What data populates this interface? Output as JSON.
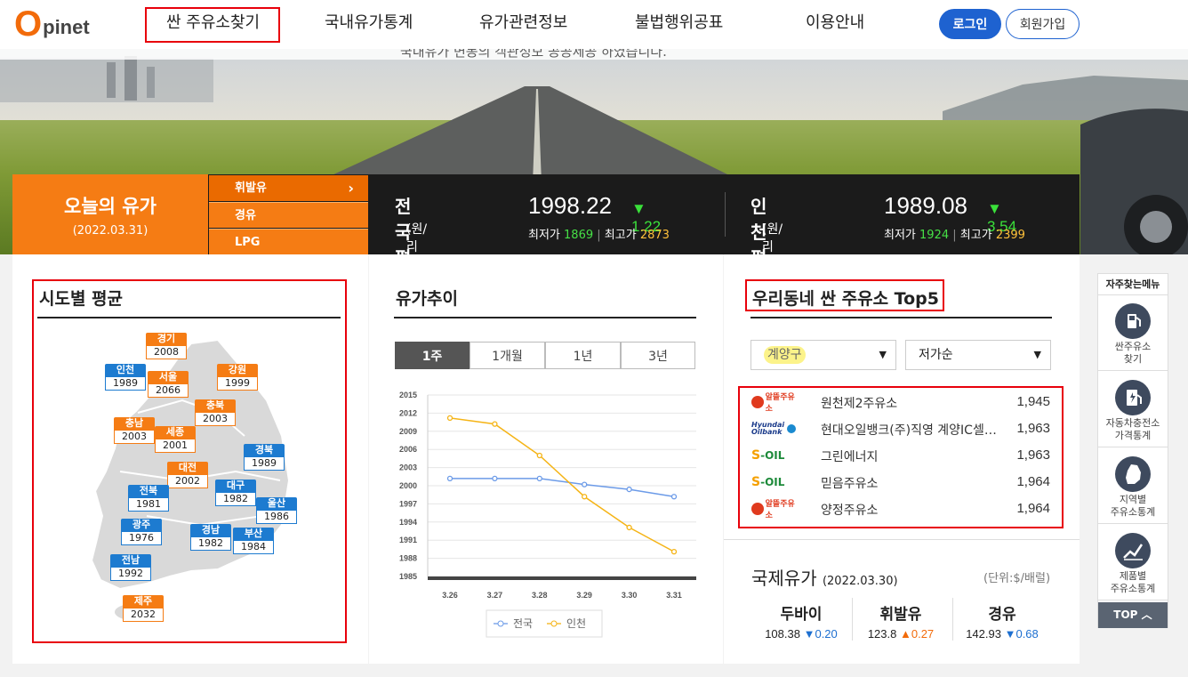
{
  "header": {
    "logo_o": "O",
    "logo_rest": "pinet",
    "nav": [
      "싼 주유소찾기",
      "국내유가통계",
      "유가관련정보",
      "불법행위공표",
      "이용안내"
    ],
    "login": "로그인",
    "join": "회원가입"
  },
  "banner": {
    "text": "국내유가 변동의 객관정보 공공제공 하였습니다."
  },
  "today": {
    "title": "오늘의 유가",
    "date": "(2022.03.31)",
    "fuels": [
      "휘발유",
      "경유",
      "LPG"
    ],
    "selected_arrow": "›"
  },
  "national": {
    "label": "전국평균",
    "unit": "(원/리터)",
    "value": "1998.22",
    "change": "▼ 1.22",
    "min_label": "최저가",
    "min": "1869",
    "sep": "|",
    "max_label": "최고가",
    "max": "2873"
  },
  "incheon": {
    "label": "인천평균",
    "unit": "(원/리터)",
    "value": "1989.08",
    "change": "▼ 3.54",
    "min_label": "최저가",
    "min": "1924",
    "sep": "|",
    "max_label": "최고가",
    "max": "2399"
  },
  "map": {
    "title": "시도별 평균",
    "regions": [
      {
        "name": "경기",
        "value": "2008",
        "color": "o"
      },
      {
        "name": "인천",
        "value": "1989",
        "color": "b"
      },
      {
        "name": "서울",
        "value": "2066",
        "color": "o"
      },
      {
        "name": "강원",
        "value": "1999",
        "color": "o"
      },
      {
        "name": "충북",
        "value": "2003",
        "color": "o"
      },
      {
        "name": "충남",
        "value": "2003",
        "color": "o"
      },
      {
        "name": "세종",
        "value": "2001",
        "color": "o"
      },
      {
        "name": "경북",
        "value": "1989",
        "color": "b"
      },
      {
        "name": "대전",
        "value": "2002",
        "color": "o"
      },
      {
        "name": "대구",
        "value": "1982",
        "color": "b"
      },
      {
        "name": "전북",
        "value": "1981",
        "color": "b"
      },
      {
        "name": "울산",
        "value": "1986",
        "color": "b"
      },
      {
        "name": "광주",
        "value": "1976",
        "color": "b"
      },
      {
        "name": "경남",
        "value": "1982",
        "color": "b"
      },
      {
        "name": "부산",
        "value": "1984",
        "color": "b"
      },
      {
        "name": "전남",
        "value": "1992",
        "color": "b"
      },
      {
        "name": "제주",
        "value": "2032",
        "color": "o"
      }
    ]
  },
  "trend": {
    "title": "유가추이",
    "tabs": [
      "1주",
      "1개월",
      "1년",
      "3년"
    ]
  },
  "chart_data": {
    "type": "line",
    "x": [
      "3.26",
      "3.27",
      "3.28",
      "3.29",
      "3.30",
      "3.31"
    ],
    "yticks": [
      "2015",
      "2012",
      "2009",
      "2006",
      "2003",
      "2000",
      "1997",
      "1994",
      "1991",
      "1988",
      "1985"
    ],
    "ylim": [
      1985,
      2015
    ],
    "series": [
      {
        "name": "전국",
        "color": "#6c9be8",
        "values": [
          2001.2,
          2001.2,
          2001.2,
          2000.2,
          1999.4,
          1998.2
        ]
      },
      {
        "name": "인천",
        "color": "#f5b416",
        "values": [
          2011.2,
          2010.2,
          2005.0,
          1998.2,
          1993.1,
          1989.1
        ]
      }
    ],
    "legend": "bottom"
  },
  "top5": {
    "title": "우리동네 싼 주유소 Top5",
    "district": "계양구",
    "sort": "저가순",
    "stations": [
      {
        "brand": "알뜰주유소",
        "name": "원천제2주유소",
        "price": "1,945"
      },
      {
        "brand": "Hyundai Oilbank",
        "name": "현대오일뱅크(주)직영 계양IC셀프주유소",
        "price": "1,963"
      },
      {
        "brand": "S-OIL",
        "name": "그린에너지",
        "price": "1,963"
      },
      {
        "brand": "S-OIL",
        "name": "믿음주유소",
        "price": "1,964"
      },
      {
        "brand": "알뜰주유소",
        "name": "양정주유소",
        "price": "1,964"
      }
    ]
  },
  "intl": {
    "title": "국제유가",
    "date": "(2022.03.30)",
    "unit": "(단위:$/배럴)",
    "items": [
      {
        "name": "두바이",
        "value": "108.38",
        "arrow": "▼",
        "change": "0.20",
        "dir": "down"
      },
      {
        "name": "휘발유",
        "value": "123.8",
        "arrow": "▲",
        "change": "0.27",
        "dir": "up"
      },
      {
        "name": "경유",
        "value": "142.93",
        "arrow": "▼",
        "change": "0.68",
        "dir": "down"
      }
    ]
  },
  "quick": {
    "title": "자주찾는메뉴",
    "items": [
      {
        "icon": "gas-station-icon",
        "line1": "싼주유소",
        "line2": "찾기"
      },
      {
        "icon": "ev-charger-icon",
        "line1": "자동차충전소",
        "line2": "가격통계"
      },
      {
        "icon": "korea-map-icon",
        "line1": "지역별",
        "line2": "주유소통계"
      },
      {
        "icon": "chart-line-icon",
        "line1": "제품별",
        "line2": "주유소통계"
      }
    ],
    "top": "TOP"
  }
}
